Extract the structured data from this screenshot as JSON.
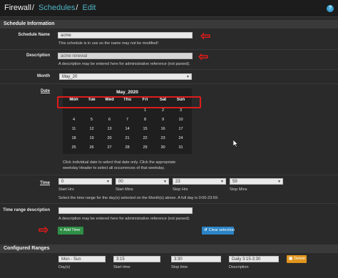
{
  "breadcrumb": {
    "part1": "Firewall",
    "part2": "Schedules",
    "part3": "Edit",
    "sep": "/"
  },
  "help_icon": "help-icon",
  "schedule_info": {
    "heading": "Schedule Information",
    "name_label": "Schedule Name",
    "name_value": "acme",
    "name_hint": "This schedule is in use so the name may not be modified!",
    "desc_label": "Description",
    "desc_value": "acme renewal",
    "desc_hint": "A description may be entered here for administrative reference (not parsed).",
    "month_label": "Month",
    "month_value": "May_20",
    "date_label": "Date",
    "calendar": {
      "title": "May_2020",
      "weekdays": [
        "Mon",
        "Tue",
        "Wed",
        "Thu",
        "Fri",
        "Sat",
        "Sun"
      ],
      "days": [
        "1",
        "2",
        "3",
        "4",
        "5",
        "6",
        "7",
        "8",
        "9",
        "10",
        "11",
        "12",
        "13",
        "14",
        "15",
        "16",
        "17",
        "18",
        "19",
        "20",
        "21",
        "22",
        "23",
        "24",
        "25",
        "26",
        "27",
        "28",
        "29",
        "30",
        "31"
      ]
    },
    "date_hint_1": "Click individual date to select that date only. Click the appropriate",
    "date_hint_2": "weekday Header to select all occurrences of that weekday.",
    "time_label": "Time",
    "start_hrs": "0",
    "start_mins": "00",
    "stop_hrs": "23",
    "stop_mins": "59",
    "start_hrs_label": "Start Hrs",
    "start_mins_label": "Start Mins",
    "stop_hrs_label": "Stop Hrs",
    "stop_mins_label": "Stop Mins",
    "time_hint": "Select the time range for the day(s) selected on the Month(s) above. A full day is 0:00-23:59.",
    "range_desc_label": "Time range description",
    "range_desc_value": "",
    "range_desc_hint": "A description may be entered here for administrative reference (not parsed).",
    "add_time": "Add Time",
    "clear_selection": "Clear selection"
  },
  "configured": {
    "heading": "Configured Ranges",
    "days_value": "Mon - Sun",
    "start_value": "3:15",
    "stop_value": "3:30",
    "desc_value": "Daily 3:15-3:30",
    "days_label": "Day(s)",
    "start_label": "Start time",
    "stop_label": "Stop time",
    "desc_label": "Description",
    "delete": "Delete"
  },
  "colors": {
    "accent_red": "#e01b1b",
    "link": "#4fb3c4",
    "add_green": "#2f8f46",
    "clear_blue": "#2b84c6",
    "delete_orange": "#e0951d"
  }
}
